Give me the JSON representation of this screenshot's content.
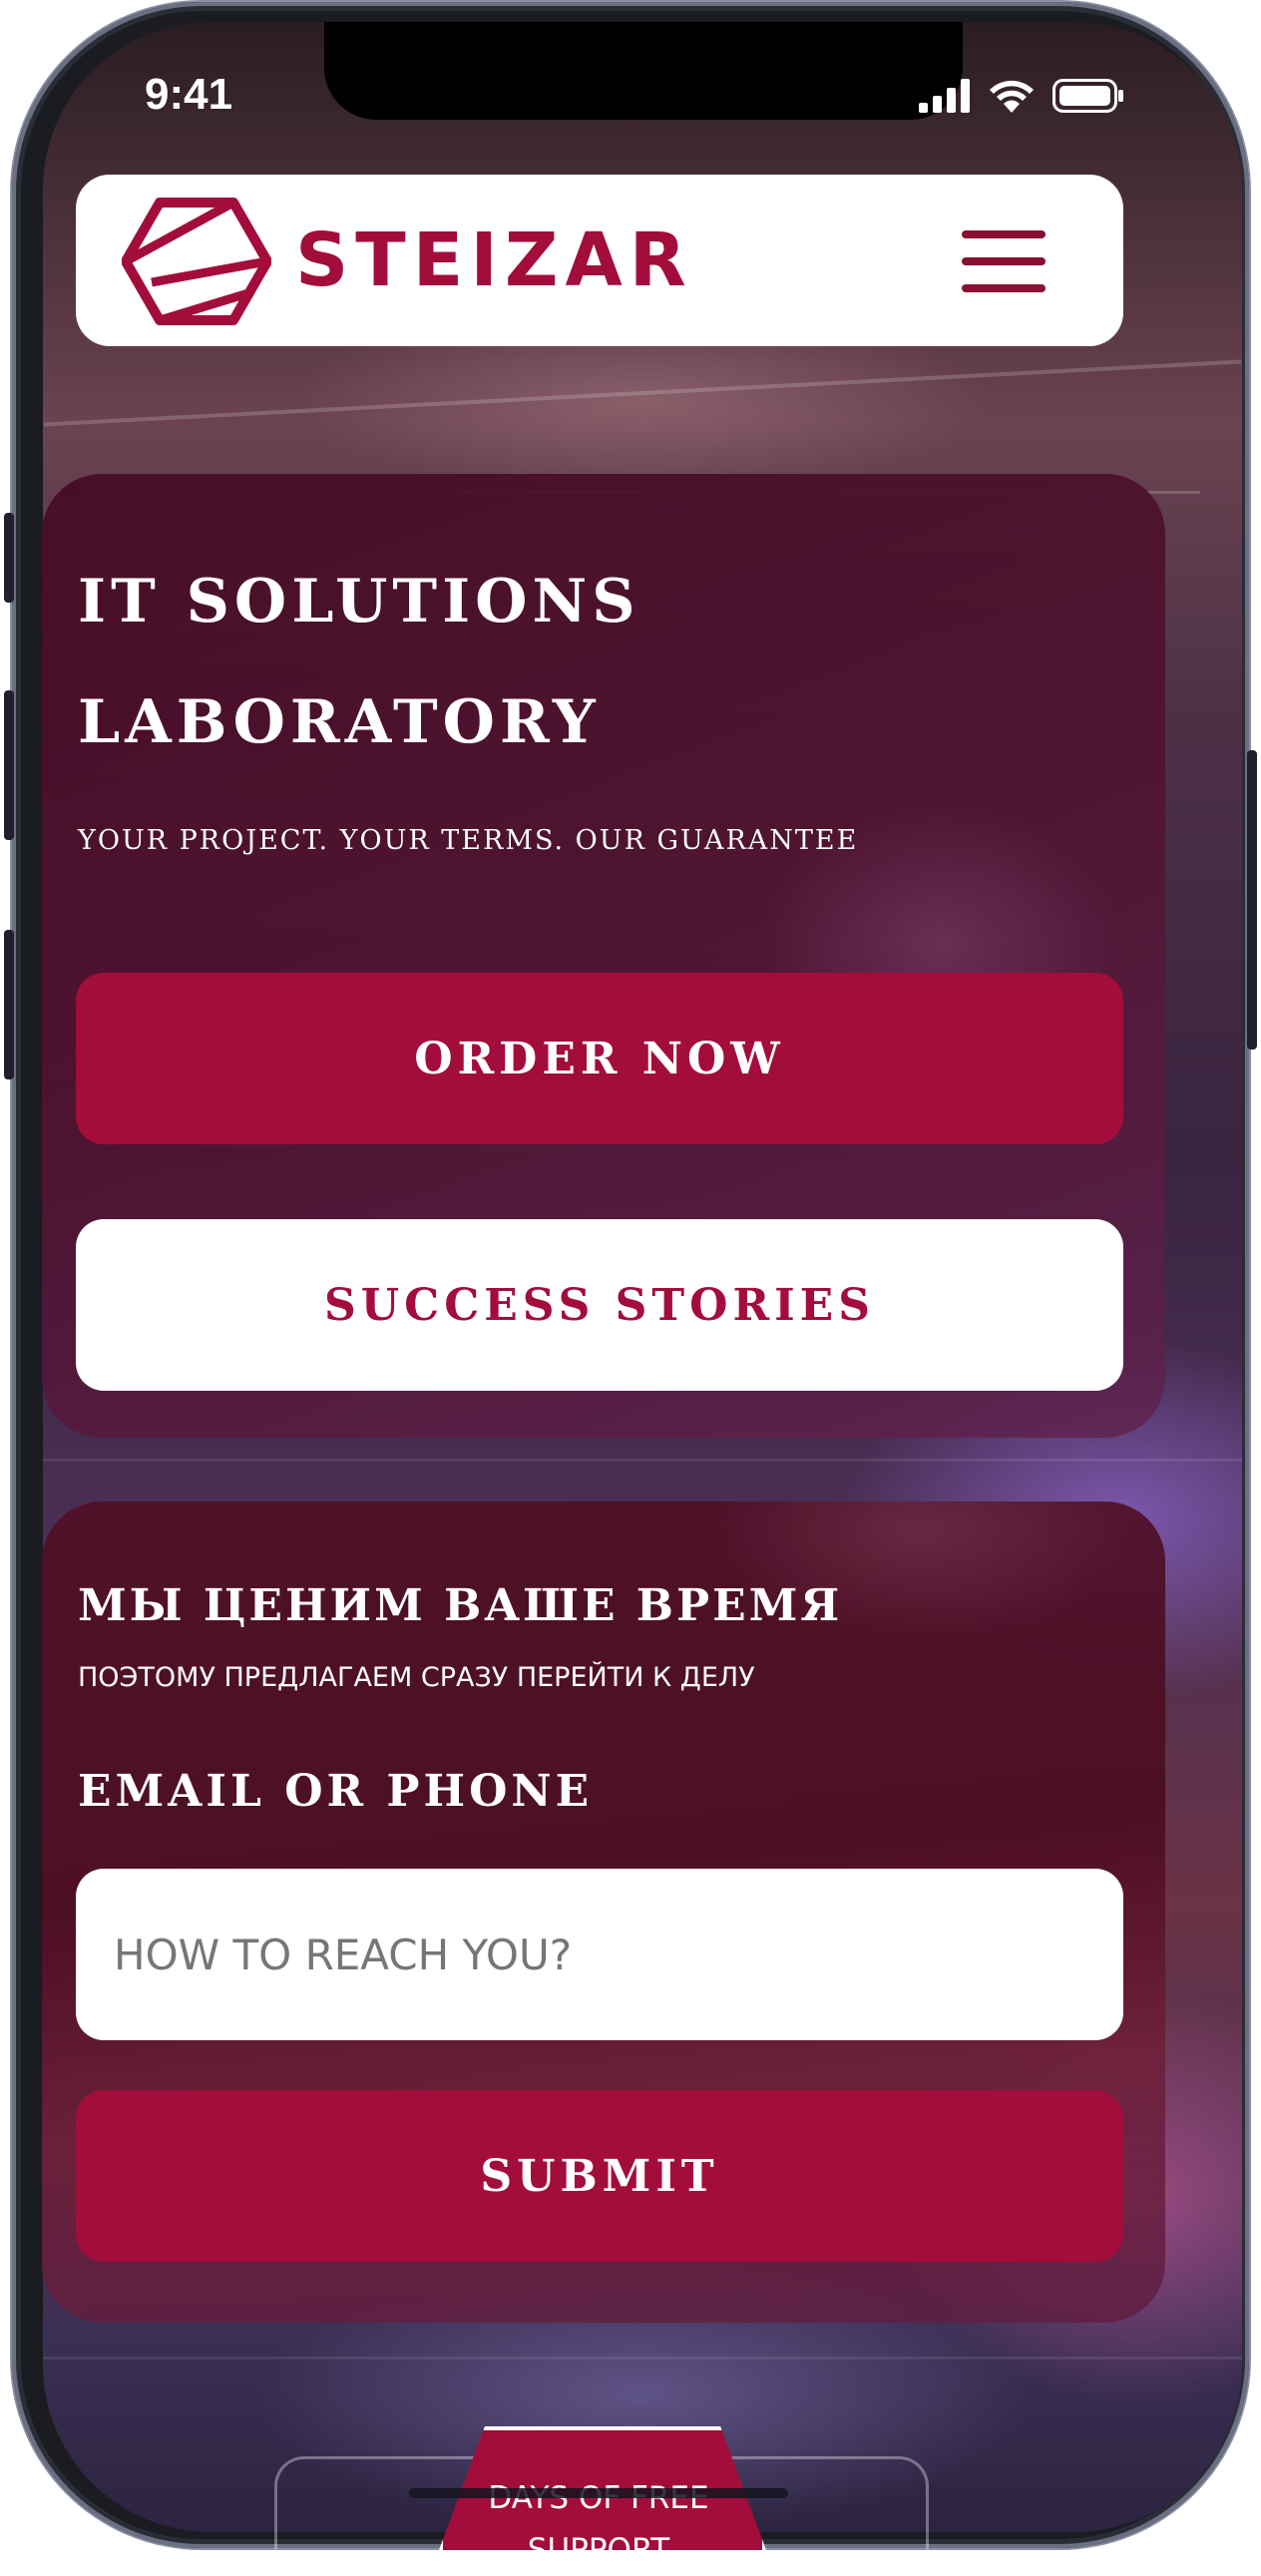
{
  "status_bar": {
    "time": "9:41"
  },
  "navbar": {
    "brand": "STEIZAR",
    "brand_color": "#a30d3b"
  },
  "hero": {
    "title_line1": "IT SOLUTIONS",
    "title_line2": "LABORATORY",
    "subtitle": "YOUR PROJECT. YOUR TERMS. OUR GUARANTEE",
    "order_button": "ORDER NOW",
    "stories_button": "SUCCESS STORIES"
  },
  "contact_form": {
    "title": "МЫ ЦЕНИМ ВАШЕ ВРЕМЯ",
    "subtitle": "ПОЭТОМУ ПРЕДЛАГАЕМ СРАЗУ ПЕРЕЙТИ К ДЕЛУ",
    "field_label": "EMAIL OR PHONE",
    "input_value": "",
    "input_placeholder": "HOW TO REACH YOU?",
    "submit_button": "SUBMIT"
  },
  "bottom_tab": {
    "label": "DAYS OF FREE SUPPORT"
  },
  "icons": [
    "hexagon-logo-icon",
    "menu-icon",
    "signal-icon",
    "wifi-icon",
    "battery-icon"
  ],
  "colors": {
    "accent": "#a30d3b",
    "card": "#4a0f24",
    "white": "#ffffff"
  }
}
